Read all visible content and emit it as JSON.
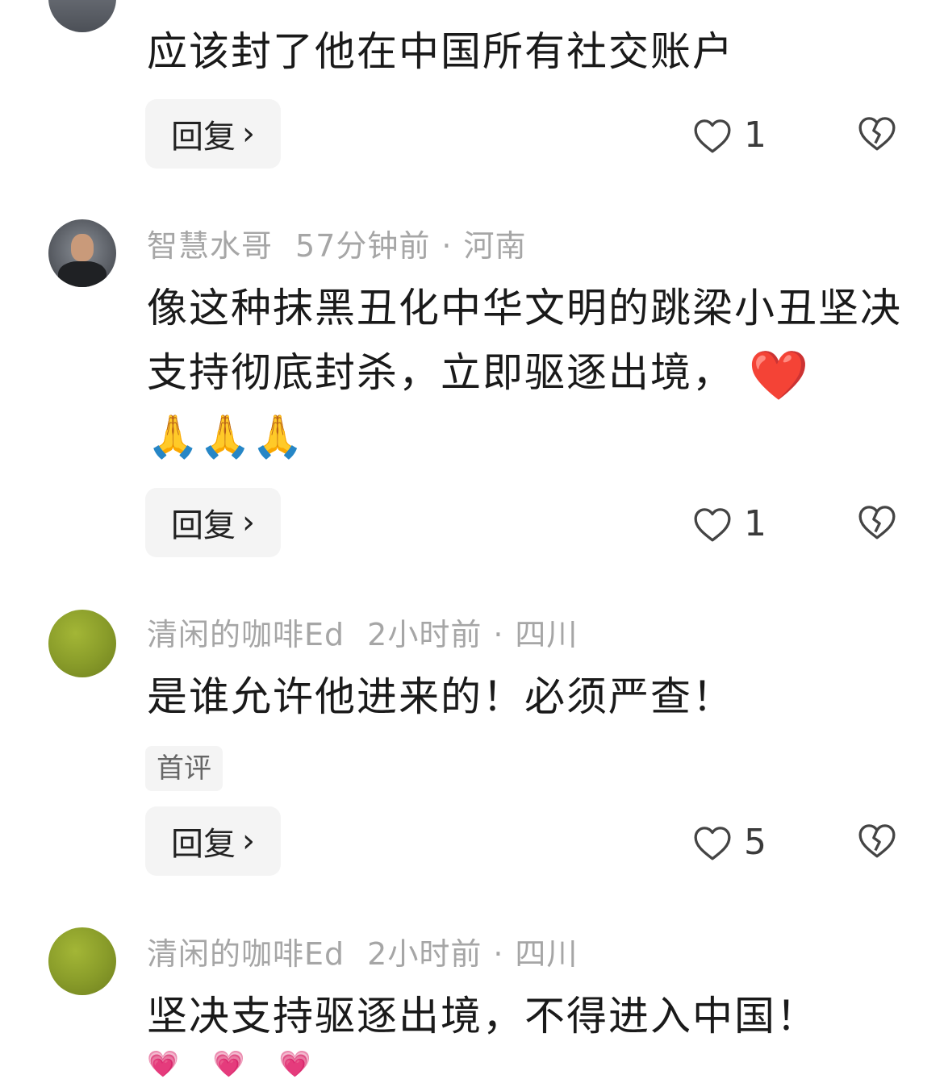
{
  "comments": [
    {
      "text": "应该封了他在中国所有社交账户",
      "reply_label": "回复",
      "likes": "1"
    },
    {
      "username": "智慧水哥",
      "time": "57分钟前",
      "location": "河南",
      "text": "像这种抹黑丑化中华文明的跳梁小丑坚决支持彻底封杀，立即驱逐出境，",
      "emoji_heart": "❤️",
      "emoji_pray": "🙏🙏🙏",
      "reply_label": "回复",
      "likes": "1"
    },
    {
      "username": "清闲的咖啡Ed",
      "time": "2小时前",
      "location": "四川",
      "text": "是谁允许他进来的！必须严查！",
      "tag": "首评",
      "reply_label": "回复",
      "likes": "5"
    },
    {
      "username": "清闲的咖啡Ed",
      "time": "2小时前",
      "location": "四川",
      "text": "坚决支持驱逐出境，不得进入中国！",
      "emoji_row": "💗💗💗"
    }
  ],
  "separator": "·",
  "icons": {
    "chevron": "chevron-right-icon",
    "like": "heart-outline-icon",
    "dislike": "broken-heart-icon"
  }
}
